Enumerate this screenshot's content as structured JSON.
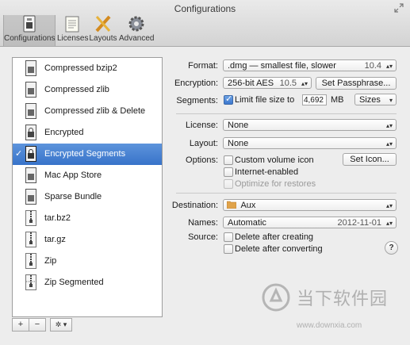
{
  "window": {
    "title": "Configurations"
  },
  "toolbar": {
    "items": [
      {
        "label": "Configurations",
        "icon": "configurations-icon",
        "active": true
      },
      {
        "label": "Licenses",
        "icon": "licenses-icon",
        "active": false
      },
      {
        "label": "Layouts",
        "icon": "layouts-icon",
        "active": false
      },
      {
        "label": "Advanced",
        "icon": "gear-icon",
        "active": false
      }
    ]
  },
  "config_list": {
    "items": [
      {
        "label": "Compressed bzip2"
      },
      {
        "label": "Compressed zlib"
      },
      {
        "label": "Compressed zlib & Delete"
      },
      {
        "label": "Encrypted"
      },
      {
        "label": "Encrypted Segments",
        "selected": true
      },
      {
        "label": "Mac App Store"
      },
      {
        "label": "Sparse Bundle"
      },
      {
        "label": "tar.bz2"
      },
      {
        "label": "tar.gz"
      },
      {
        "label": "Zip"
      },
      {
        "label": "Zip Segmented"
      }
    ],
    "add_label": "+",
    "remove_label": "−",
    "action_label": "✲ ▾"
  },
  "settings": {
    "format_label": "Format:",
    "format_value": ".dmg — smallest file, slower",
    "format_version": "10.4",
    "encryption_label": "Encryption:",
    "encryption_value": "256-bit AES",
    "encryption_version": "10.5",
    "set_passphrase_label": "Set Passphrase...",
    "segments_label": "Segments:",
    "limit_file_size_label": "Limit file size to",
    "limit_file_size_checked": true,
    "file_size_value": "4,692",
    "file_size_unit": "MB",
    "sizes_label": "Sizes",
    "license_label": "License:",
    "license_value": "None",
    "layout_label": "Layout:",
    "layout_value": "None",
    "options_label": "Options:",
    "custom_volume_icon_label": "Custom volume icon",
    "set_icon_label": "Set Icon...",
    "internet_enabled_label": "Internet-enabled",
    "optimize_restores_label": "Optimize for restores",
    "destination_label": "Destination:",
    "destination_value": "Aux",
    "names_label": "Names:",
    "names_value": "Automatic",
    "names_date": "2012-11-01",
    "source_label": "Source:",
    "delete_after_creating_label": "Delete after creating",
    "delete_after_converting_label": "Delete after converting",
    "help_label": "?"
  },
  "watermark": {
    "text": "当下软件园",
    "url": "www.downxia.com"
  },
  "colors": {
    "selection": "#3873c9",
    "window_bg": "#ededed"
  }
}
